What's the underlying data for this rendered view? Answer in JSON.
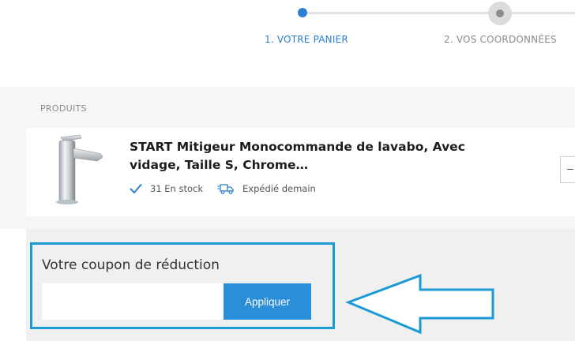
{
  "stepper": {
    "steps": [
      {
        "label": "1. VOTRE PANIER",
        "state": "active"
      },
      {
        "label": "2. VOS COORDONNÉES",
        "state": "upcoming"
      }
    ]
  },
  "products": {
    "heading": "PRODUITS",
    "items": [
      {
        "title": "START Mitigeur Monocommande de lavabo, Avec vidage, Taille S, Chrome…",
        "stock": "31 En stock",
        "shipping": "Expédié demain",
        "image_icon": "faucet-image",
        "quantity_control": "minus"
      }
    ]
  },
  "coupon": {
    "title": "Votre coupon de réduction",
    "input_value": "",
    "input_placeholder": "",
    "apply_label": "Appliquer"
  },
  "colors": {
    "accent": "#2a7fd0",
    "button": "#2a8fd8",
    "highlight_border": "#1b9ad6"
  },
  "annotation": {
    "arrow_icon": "left-arrow-annotation"
  }
}
